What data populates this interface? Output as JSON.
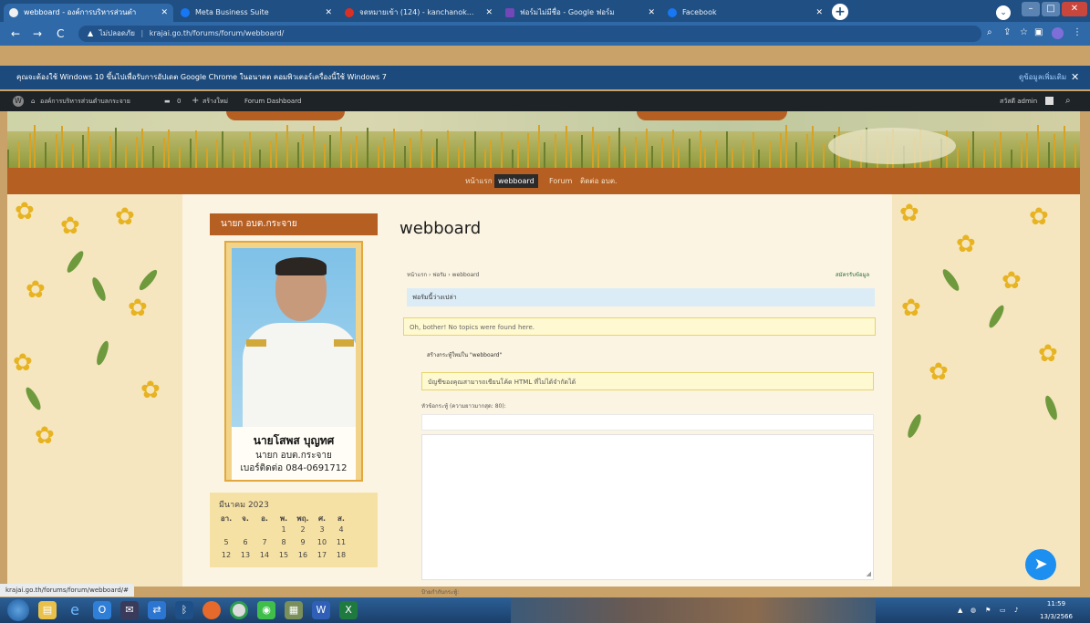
{
  "browser": {
    "tabs": [
      {
        "label": "webboard - องค์การบริหารส่วนตำ",
        "active": true,
        "color": "#f0f0f0"
      },
      {
        "label": "Meta Business Suite",
        "active": false,
        "color": "#1877f2"
      },
      {
        "label": "จดหมายเข้า (124) - kanchanok...",
        "active": false,
        "color": "#d93025"
      },
      {
        "label": "ฟอร์มไม่มีชื่อ - Google ฟอร์ม",
        "active": false,
        "color": "#7248b9"
      },
      {
        "label": "Facebook",
        "active": false,
        "color": "#1877f2"
      }
    ],
    "address": {
      "security_label": "ไม่ปลอดภัย",
      "url": "krajai.go.th/forums/forum/webboard/"
    },
    "infobar": {
      "message": "คุณจะต้องใช้ Windows 10 ขึ้นไปเพื่อรับการอัปเดต Google Chrome ในอนาคต คอมพิวเตอร์เครื่องนี้ใช้ Windows 7",
      "link": "ดูข้อมูลเพิ่มเติม",
      "close": "✕"
    }
  },
  "wpbar": {
    "site_name": "องค์การบริหารส่วนตำบลกระจาย",
    "comments_count": "0",
    "new_label": "สร้างใหม่",
    "dashboard_label": "Forum Dashboard",
    "user_label": "สวัสดี admin"
  },
  "site": {
    "nav": [
      {
        "label": "หน้าแรก",
        "current": false
      },
      {
        "label": "webboard",
        "current": true
      },
      {
        "label": "Forum",
        "current": false
      },
      {
        "label": "ติดต่อ อบต.",
        "current": false
      }
    ]
  },
  "sidebar": {
    "title": "นายก อบต.กระจาย",
    "person_name": "นายโสพส บุญทศ",
    "person_position": "นายก อบต.กระจาย",
    "person_phone": "เบอร์ติดต่อ 084-0691712",
    "calendar": {
      "month": "มีนาคม 2023",
      "weekdays": [
        "อา.",
        "จ.",
        "อ.",
        "พ.",
        "พฤ.",
        "ศ.",
        "ส."
      ],
      "days": [
        [
          "",
          "",
          "",
          "1",
          "2",
          "3",
          "4"
        ],
        [
          "5",
          "6",
          "7",
          "8",
          "9",
          "10",
          "11"
        ],
        [
          "12",
          "13",
          "14",
          "15",
          "16",
          "17",
          "18"
        ]
      ]
    }
  },
  "main": {
    "title": "webboard",
    "breadcrumb": "หน้าแรก › ฟอรัม › webboard",
    "subscribe": "สมัครรับข้อมูล",
    "forum_empty_info": "ฟอรัมนี้ว่างเปล่า",
    "no_topics": "Oh, bother! No topics were found here.",
    "create_topic_title": "สร้างกระทู้ใหม่ใน \"webboard\"",
    "html_notice": "บัญชีของคุณสามารถเขียนโค้ด HTML ที่ไม่ได้จำกัดได้",
    "topic_label": "หัวข้อกระทู้ (ความยาวมากสุด: 80):",
    "tags_label": "ป้ายกำกับกระทู้:"
  },
  "status_url": "krajai.go.th/forums/forum/webboard/#",
  "taskbar": {
    "time": "11:59",
    "date": "13/3/2566"
  }
}
